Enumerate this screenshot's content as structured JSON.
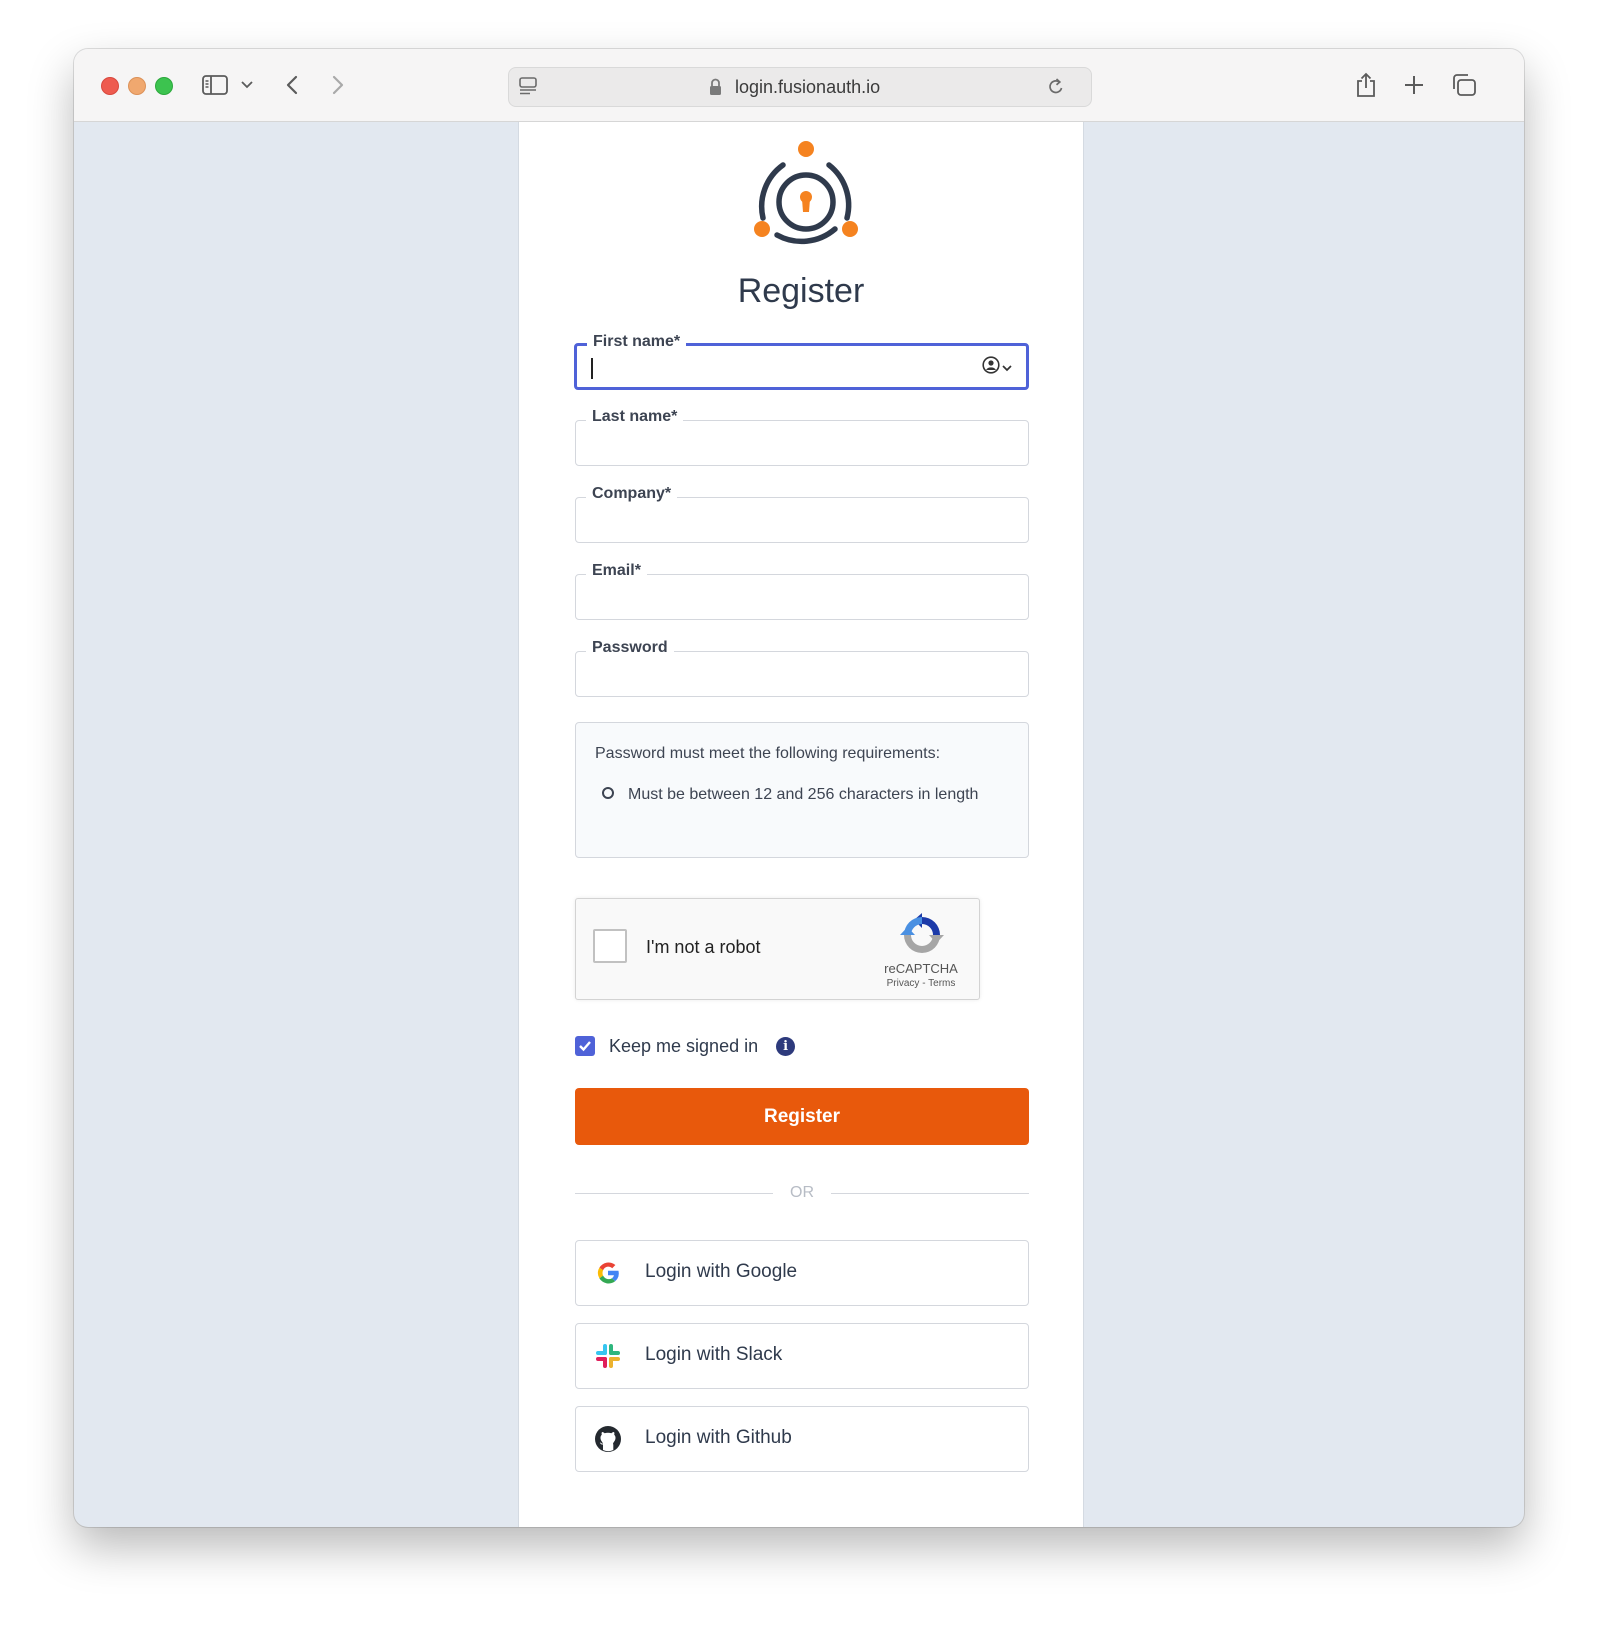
{
  "browser": {
    "url": "login.fusionauth.io"
  },
  "form": {
    "title": "Register",
    "fields": [
      {
        "label": "First name*",
        "value": "",
        "placeholder": ""
      },
      {
        "label": "Last name*",
        "value": "",
        "placeholder": ""
      },
      {
        "label": "Company*",
        "value": "",
        "placeholder": ""
      },
      {
        "label": "Email*",
        "value": "",
        "placeholder": ""
      },
      {
        "label": "Password",
        "value": "",
        "placeholder": ""
      }
    ],
    "password_requirements": {
      "title": "Password must meet the following requirements:",
      "items": [
        "Must be between 12 and 256 characters in length"
      ]
    },
    "captcha": {
      "label": "I'm not a robot",
      "brand": "reCAPTCHA",
      "links": "Privacy - Terms"
    },
    "keep_signed_in": {
      "label": "Keep me signed in",
      "checked": true,
      "info_glyph": "i"
    },
    "submit_label": "Register",
    "divider_text": "OR",
    "identity_providers": [
      {
        "label": "Login with Google",
        "icon": "google-icon"
      },
      {
        "label": "Login with Slack",
        "icon": "slack-icon"
      },
      {
        "label": "Login with Github",
        "icon": "github-icon"
      }
    ]
  },
  "colors": {
    "accent_orange": "#e8590c",
    "focus_blue": "#4f62d8",
    "page_background": "#e2e8f0"
  }
}
